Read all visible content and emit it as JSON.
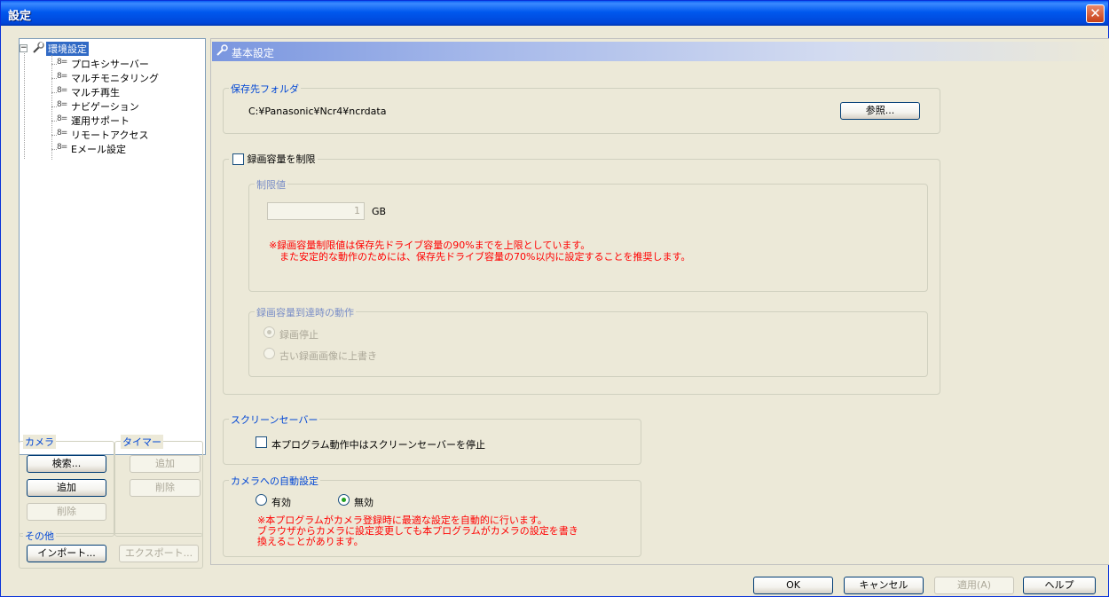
{
  "window": {
    "title": "設定",
    "close": "✕"
  },
  "tree": {
    "root": {
      "expander": "−",
      "label": "環境設定"
    },
    "items": [
      {
        "label": "プロキシサーバー"
      },
      {
        "label": "マルチモニタリング"
      },
      {
        "label": "マルチ再生"
      },
      {
        "label": "ナビゲーション"
      },
      {
        "label": "運用サポート"
      },
      {
        "label": "リモートアクセス"
      },
      {
        "label": "Eメール設定"
      }
    ]
  },
  "left_groups": {
    "camera": {
      "label": "カメラ",
      "search": "検索...",
      "add": "追加",
      "delete": "削除"
    },
    "timer": {
      "label": "タイマー",
      "add": "追加",
      "delete": "削除"
    },
    "other": {
      "label": "その他",
      "import": "インポート...",
      "export": "エクスポート..."
    }
  },
  "panel": {
    "header": "基本設定",
    "save_folder": {
      "label": "保存先フォルダ",
      "path": "C:¥Panasonic¥Ncr4¥ncrdata",
      "browse": "参照..."
    },
    "limit": {
      "checkbox_label": "録画容量を制限",
      "limit_group_label": "制限値",
      "limit_value": "1",
      "unit": "GB",
      "note1": "※録画容量制限値は保存先ドライブ容量の90%までを上限としています。",
      "note2": "また安定的な動作のためには、保存先ドライブ容量の70%以内に設定することを推奨します。",
      "action_group_label": "録画容量到達時の動作",
      "action_stop": "録画停止",
      "action_overwrite": "古い録画画像に上書き"
    },
    "screensaver": {
      "label": "スクリーンセーバー",
      "checkbox_label": "本プログラム動作中はスクリーンセーバーを停止"
    },
    "camera_auto": {
      "label": "カメラへの自動設定",
      "enabled": "有効",
      "disabled": "無効",
      "note1": "※本プログラムがカメラ登録時に最適な設定を自動的に行います。",
      "note2": "ブラウザからカメラに設定変更しても本プログラムがカメラの設定を書き",
      "note3": "換えることがあります。"
    }
  },
  "footer": {
    "ok": "OK",
    "cancel": "キャンセル",
    "apply": "適用(A)",
    "help": "ヘルプ"
  }
}
